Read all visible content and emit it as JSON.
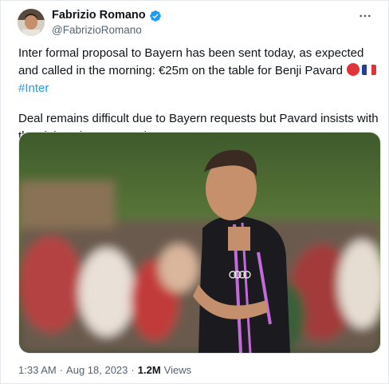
{
  "author": {
    "name": "Fabrizio Romano",
    "handle": "@FabrizioRomano",
    "verified": true
  },
  "tweet": {
    "paragraph1_text": "Inter formal proposal to Bayern has been sent today, as expected and called in the morning: €25m on the table for Benji Pavard",
    "paragraph1_hashtag": "#Inter",
    "emojis": [
      "austria-flag-emoji",
      "france-flag-emoji"
    ],
    "paragraph2_text": "Deal remains difficult due to Bayern requests but Pavard insists with the club as he wants to leave."
  },
  "media": {
    "description_icon": "player-photo",
    "sponsor_logo": "audi-logo"
  },
  "meta": {
    "time": "1:33 AM",
    "date": "Aug 18, 2023",
    "separator": "·",
    "views_count": "1.2M",
    "views_label": "Views"
  },
  "colors": {
    "link": "#1d9bf0",
    "verified": "#1d9bf0",
    "secondary_text": "#536471"
  }
}
